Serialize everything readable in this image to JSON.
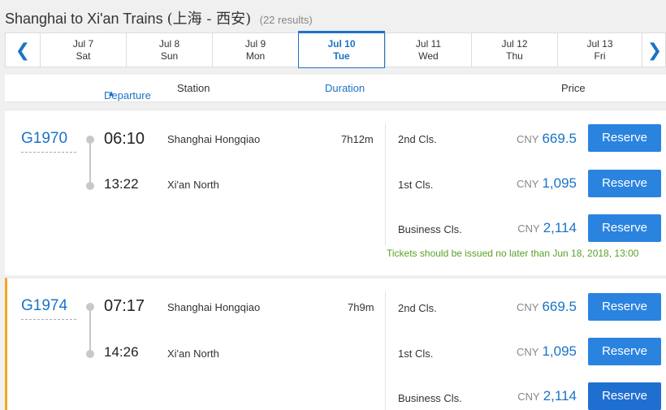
{
  "page": {
    "title_en": "Shanghai to Xi'an Trains",
    "title_cn": "(上海 - 西安)",
    "results": "(22 results)"
  },
  "dates": [
    {
      "date": "Jul 7",
      "weekday": "Sat"
    },
    {
      "date": "Jul 8",
      "weekday": "Sun"
    },
    {
      "date": "Jul 9",
      "weekday": "Mon"
    },
    {
      "date": "Jul 10",
      "weekday": "Tue"
    },
    {
      "date": "Jul 11",
      "weekday": "Wed"
    },
    {
      "date": "Jul 12",
      "weekday": "Thu"
    },
    {
      "date": "Jul 13",
      "weekday": "Fri"
    }
  ],
  "selected_date_index": 3,
  "icons": {
    "prev": "chevron-left-icon",
    "next": "chevron-right-icon",
    "sort": "sort-icon"
  },
  "columns": {
    "departure": "Departure",
    "station": "Station",
    "duration": "Duration",
    "price": "Price"
  },
  "trains": [
    {
      "number": "G1970",
      "depart_time": "06:10",
      "arrive_time": "13:22",
      "depart_station": "Shanghai Hongqiao",
      "arrive_station": "Xi'an North",
      "duration": "7h12m",
      "fares": [
        {
          "class": "2nd Cls.",
          "currency": "CNY",
          "price": "669.5",
          "button": "Reserve"
        },
        {
          "class": "1st Cls.",
          "currency": "CNY",
          "price": "1,095",
          "button": "Reserve"
        },
        {
          "class": "Business Cls.",
          "currency": "CNY",
          "price": "2,114",
          "button": "Reserve"
        }
      ],
      "notice": "Tickets should be issued no later than Jun 18, 2018, 13:00"
    },
    {
      "number": "G1974",
      "depart_time": "07:17",
      "arrive_time": "14:26",
      "depart_station": "Shanghai Hongqiao",
      "arrive_station": "Xi'an North",
      "duration": "7h9m",
      "fares": [
        {
          "class": "2nd Cls.",
          "currency": "CNY",
          "price": "669.5",
          "button": "Reserve"
        },
        {
          "class": "1st Cls.",
          "currency": "CNY",
          "price": "1,095",
          "button": "Reserve"
        },
        {
          "class": "Business Cls.",
          "currency": "CNY",
          "price": "2,114",
          "button": "Reserve"
        }
      ]
    }
  ]
}
